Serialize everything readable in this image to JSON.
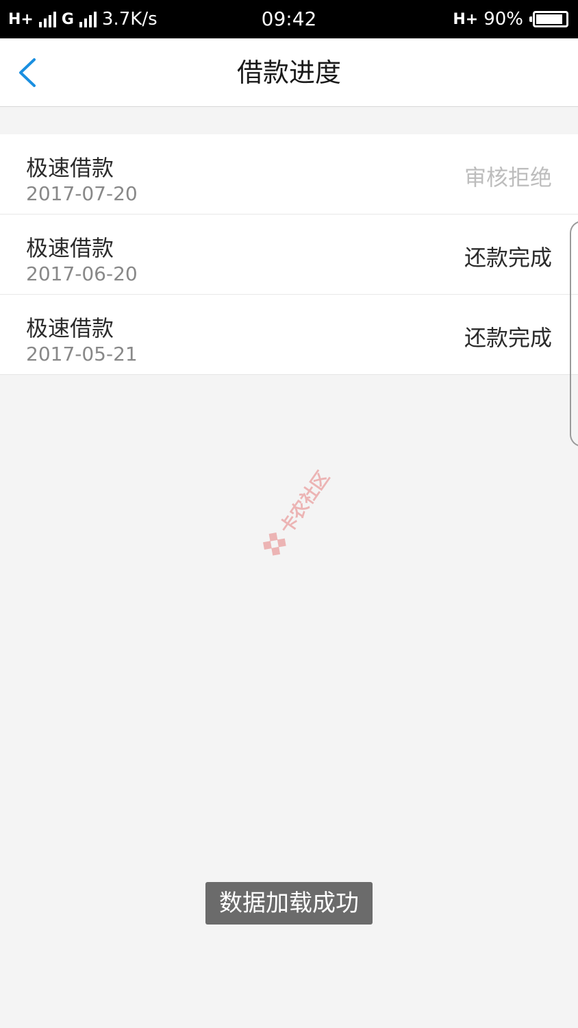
{
  "status_bar": {
    "network1": "H+",
    "network2": "G",
    "speed": "3.7K/s",
    "time": "09:42",
    "network_right": "H+",
    "battery_text": "90%",
    "battery_level": 0.9
  },
  "nav": {
    "title": "借款进度",
    "back_icon": "chevron-left-icon",
    "back_color": "#1a8fe0"
  },
  "loans": [
    {
      "name": "极速借款",
      "date": "2017-07-20",
      "status": "审核拒绝",
      "status_type": "rejected"
    },
    {
      "name": "极速借款",
      "date": "2017-06-20",
      "status": "还款完成",
      "status_type": "completed"
    },
    {
      "name": "极速借款",
      "date": "2017-05-21",
      "status": "还款完成",
      "status_type": "completed"
    }
  ],
  "watermark": {
    "text": "卡农社区"
  },
  "toast": {
    "message": "数据加载成功"
  }
}
